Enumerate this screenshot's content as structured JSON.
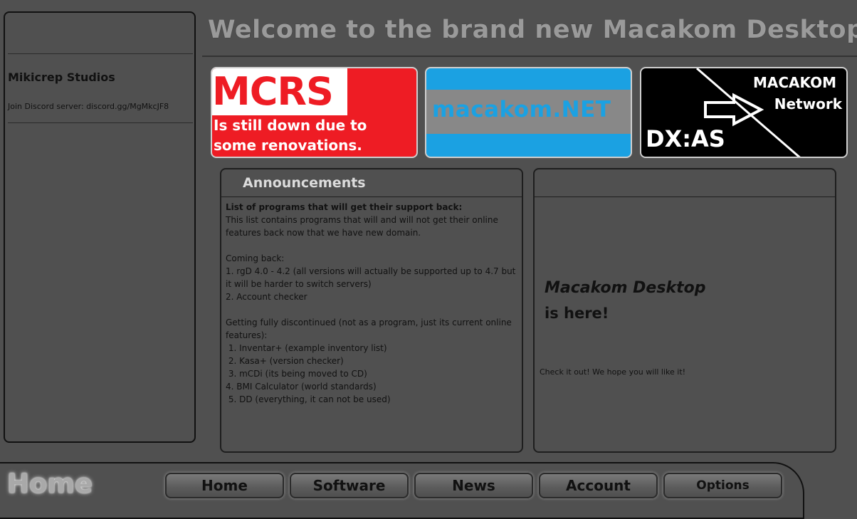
{
  "sidebar": {
    "title": "Mikicrep Studios",
    "discord_text": "Join Discord server:  discord.gg/MgMkcJF8"
  },
  "header": {
    "title": "Welcome to the brand new Macakom Desktop!!!"
  },
  "banners": {
    "mcrs": {
      "logo": "MCRS",
      "message_line1": "Is still down due to",
      "message_line2": "some renovations.",
      "bg_color": "#ee1c24"
    },
    "macakom_net": {
      "label": "macakom.NET",
      "bg_color": "#1ba1e2"
    },
    "dxas": {
      "macakom": "MACAKOM",
      "network": "Network",
      "dxas": "DX:AS",
      "icon": "arrow-right-icon"
    }
  },
  "announcements": {
    "title": "Announcements",
    "heading": "List of programs that will get their support back:",
    "body": "This list contains programs that will and will not get their online features back now that we have new domain.\n\nComing back:\n1. rgD 4.0 - 4.2 (all versions will actually be supported up to 4.7 but it will be harder to switch servers)\n2. Account checker\n\nGetting fully discontinued (not as a program, just its current online features):\n 1. Inventar+ (example inventory list)\n 2. Kasa+ (version checker)\n 3. mCDi (its being moved to CD)\n4. BMI Calculator (world standards)\n 5. DD (everything, it can not be used)"
  },
  "promo": {
    "line1": "Macakom Desktop",
    "line2": "is here!",
    "note": "Check it out! We hope you will like it!"
  },
  "bottom": {
    "current_page": "Home"
  },
  "nav": {
    "home": "Home",
    "software": "Software",
    "news": "News",
    "account": "Account",
    "options": "Options"
  }
}
